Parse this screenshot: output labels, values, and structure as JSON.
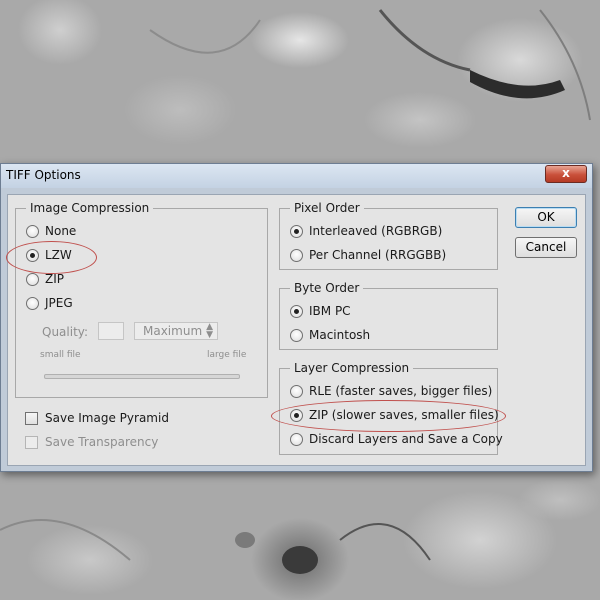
{
  "dialog": {
    "title": "TIFF Options",
    "close_label": "x"
  },
  "buttons": {
    "ok": "OK",
    "cancel": "Cancel"
  },
  "image_compression": {
    "legend": "Image Compression",
    "options": [
      "None",
      "LZW",
      "ZIP",
      "JPEG"
    ],
    "selected": "LZW",
    "quality_label": "Quality:",
    "quality_value": "",
    "quality_select": "Maximum",
    "small_file_label": "small file",
    "large_file_label": "large file"
  },
  "checkboxes": {
    "save_image_pyramid": "Save Image Pyramid",
    "save_transparency": "Save Transparency"
  },
  "pixel_order": {
    "legend": "Pixel Order",
    "options": [
      "Interleaved (RGBRGB)",
      "Per Channel (RRGGBB)"
    ],
    "selected": "Interleaved (RGBRGB)"
  },
  "byte_order": {
    "legend": "Byte Order",
    "options": [
      "IBM PC",
      "Macintosh"
    ],
    "selected": "IBM PC"
  },
  "layer_compression": {
    "legend": "Layer Compression",
    "options": [
      "RLE (faster saves, bigger files)",
      "ZIP (slower saves, smaller files)",
      "Discard Layers and Save a Copy"
    ],
    "selected": "ZIP (slower saves, smaller files)"
  },
  "colors": {
    "annotation": "#c0504d",
    "title_bar": "#c4d2e3",
    "close_button": "#c9503a"
  }
}
